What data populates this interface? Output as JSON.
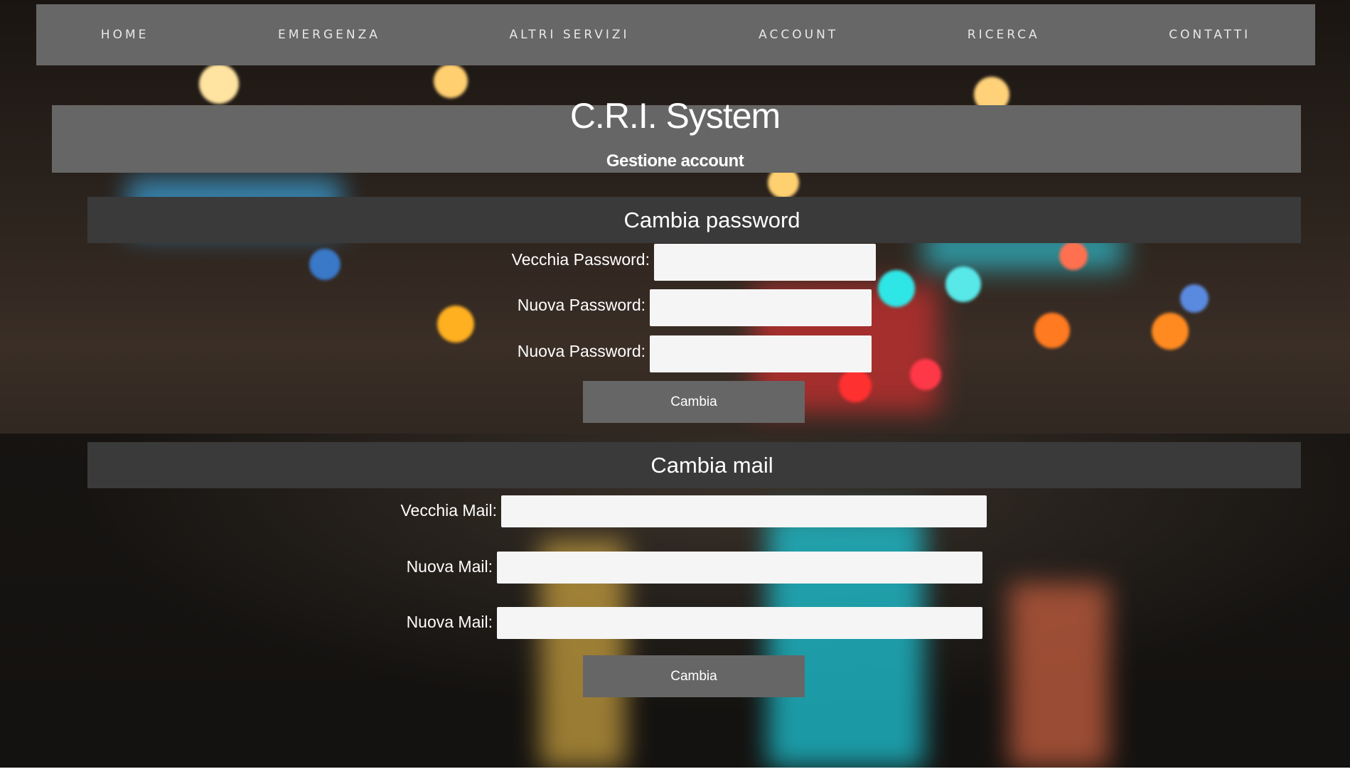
{
  "nav": {
    "items": [
      {
        "label": "HOME"
      },
      {
        "label": "EMERGENZA"
      },
      {
        "label": "ALTRI SERVIZI"
      },
      {
        "label": "ACCOUNT"
      },
      {
        "label": "RICERCA"
      },
      {
        "label": "CONTATTI"
      }
    ]
  },
  "header": {
    "title": "C.R.I. System",
    "subtitle": "Gestione account"
  },
  "password_section": {
    "title": "Cambia password",
    "old_label": "Vecchia Password:",
    "old_value": "",
    "new_label": "Nuova Password:",
    "new_value": "",
    "confirm_label": "Nuova Password:",
    "confirm_value": "",
    "submit_label": "Cambia"
  },
  "mail_section": {
    "title": "Cambia mail",
    "old_label": "Vecchia Mail:",
    "old_value": "",
    "new_label": "Nuova Mail:",
    "new_value": "",
    "confirm_label": "Nuova Mail:",
    "confirm_value": "",
    "submit_label": "Cambia"
  },
  "colors": {
    "nav_bg": "#676767",
    "header_bg": "#666666",
    "section_bar_bg": "#3a3a3a",
    "button_bg": "#666666",
    "field_bg": "#f5f5f5"
  }
}
